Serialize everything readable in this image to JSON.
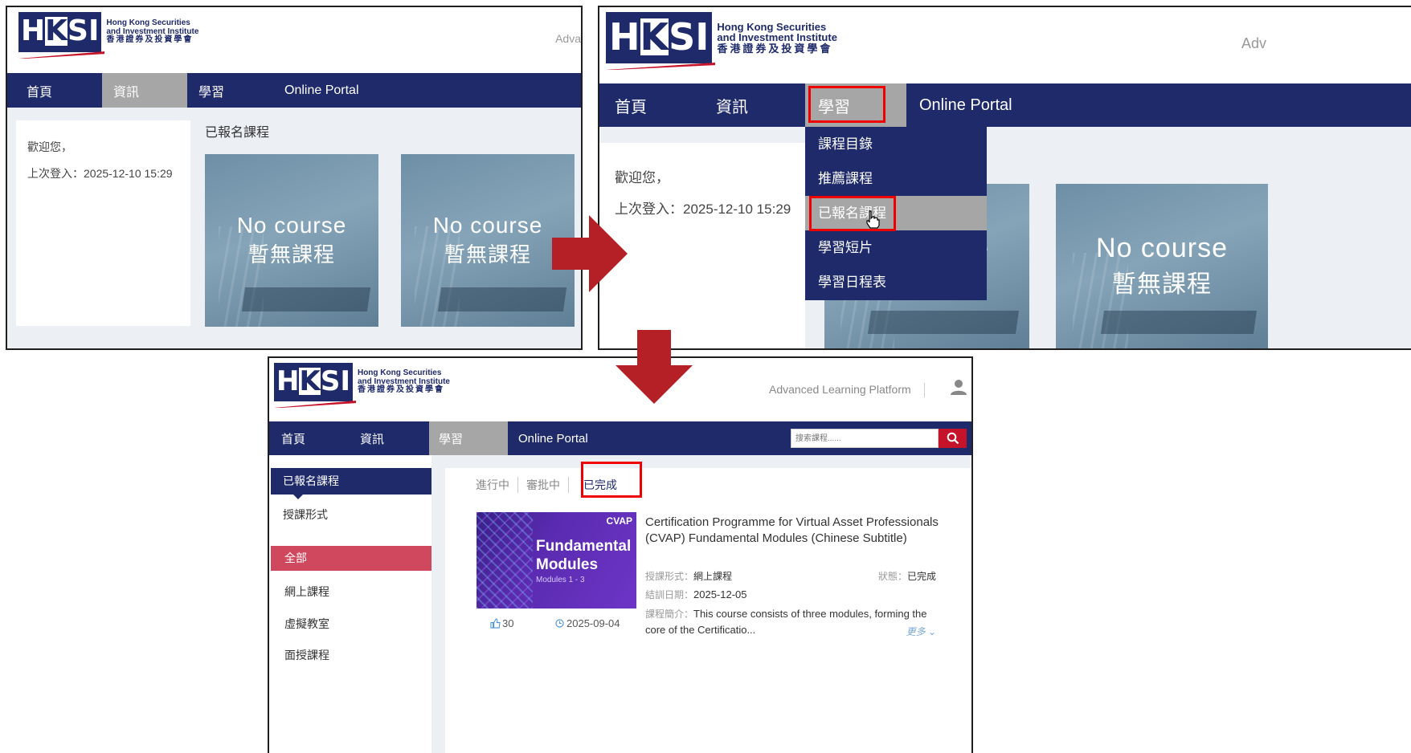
{
  "logo": {
    "en_line1": "Hong Kong Securities",
    "en_line2": "and Investment Institute",
    "zh": "香港證券及投資學會",
    "mark_left": "H",
    "mark_k": "K",
    "mark_right": "SI"
  },
  "nav": {
    "home": "首頁",
    "news": "資訊",
    "learning": "學習",
    "portal": "Online Portal"
  },
  "header_right_partial_1": "Adva",
  "header_right_partial_2": "Adv",
  "welcome": "歡迎您，",
  "last_login_label": "上次登入：",
  "last_login_value": "2025-12-10 15:29",
  "enrolled_heading": "已報名課程",
  "tiles": {
    "en": "No course",
    "zh": "暫無課程"
  },
  "dropdown": {
    "items": [
      "課程目錄",
      "推薦課程",
      "已報名課程",
      "學習短片",
      "學習日程表"
    ]
  },
  "panel3": {
    "platform": "Advanced Learning Platform",
    "search_placeholder": "搜索課程......",
    "sidebar": {
      "title": "已報名課程",
      "group": "授課形式",
      "items": [
        "全部",
        "網上課程",
        "虛擬教室",
        "面授課程"
      ]
    },
    "tabs": [
      "進行中",
      "審批中",
      "已完成"
    ],
    "course": {
      "thumb_brand": "CVAP",
      "thumb_title1": "Fundamental",
      "thumb_title2": "Modules",
      "thumb_sub": "Modules 1 - 3",
      "title": "Certification Programme for Virtual Asset Professionals (CVAP) Fundamental Modules (Chinese Subtitle)",
      "format_label": "授課形式：",
      "format_value": "網上課程",
      "status_label": "狀態：",
      "status_value": "已完成",
      "end_label": "結訓日期：",
      "end_value": "2025-12-05",
      "intro_label": "課程簡介：",
      "intro_text": "This course consists of three modules, forming the core of the Certificatio...",
      "more": "更多",
      "likes": "30",
      "date": "2025-09-04"
    }
  },
  "colors": {
    "navy": "#1f2a6b",
    "active_grey": "#a6a6a6",
    "arrow_red": "#b42025",
    "highlight_red": "#e00000",
    "pink_active": "#d0485e"
  }
}
